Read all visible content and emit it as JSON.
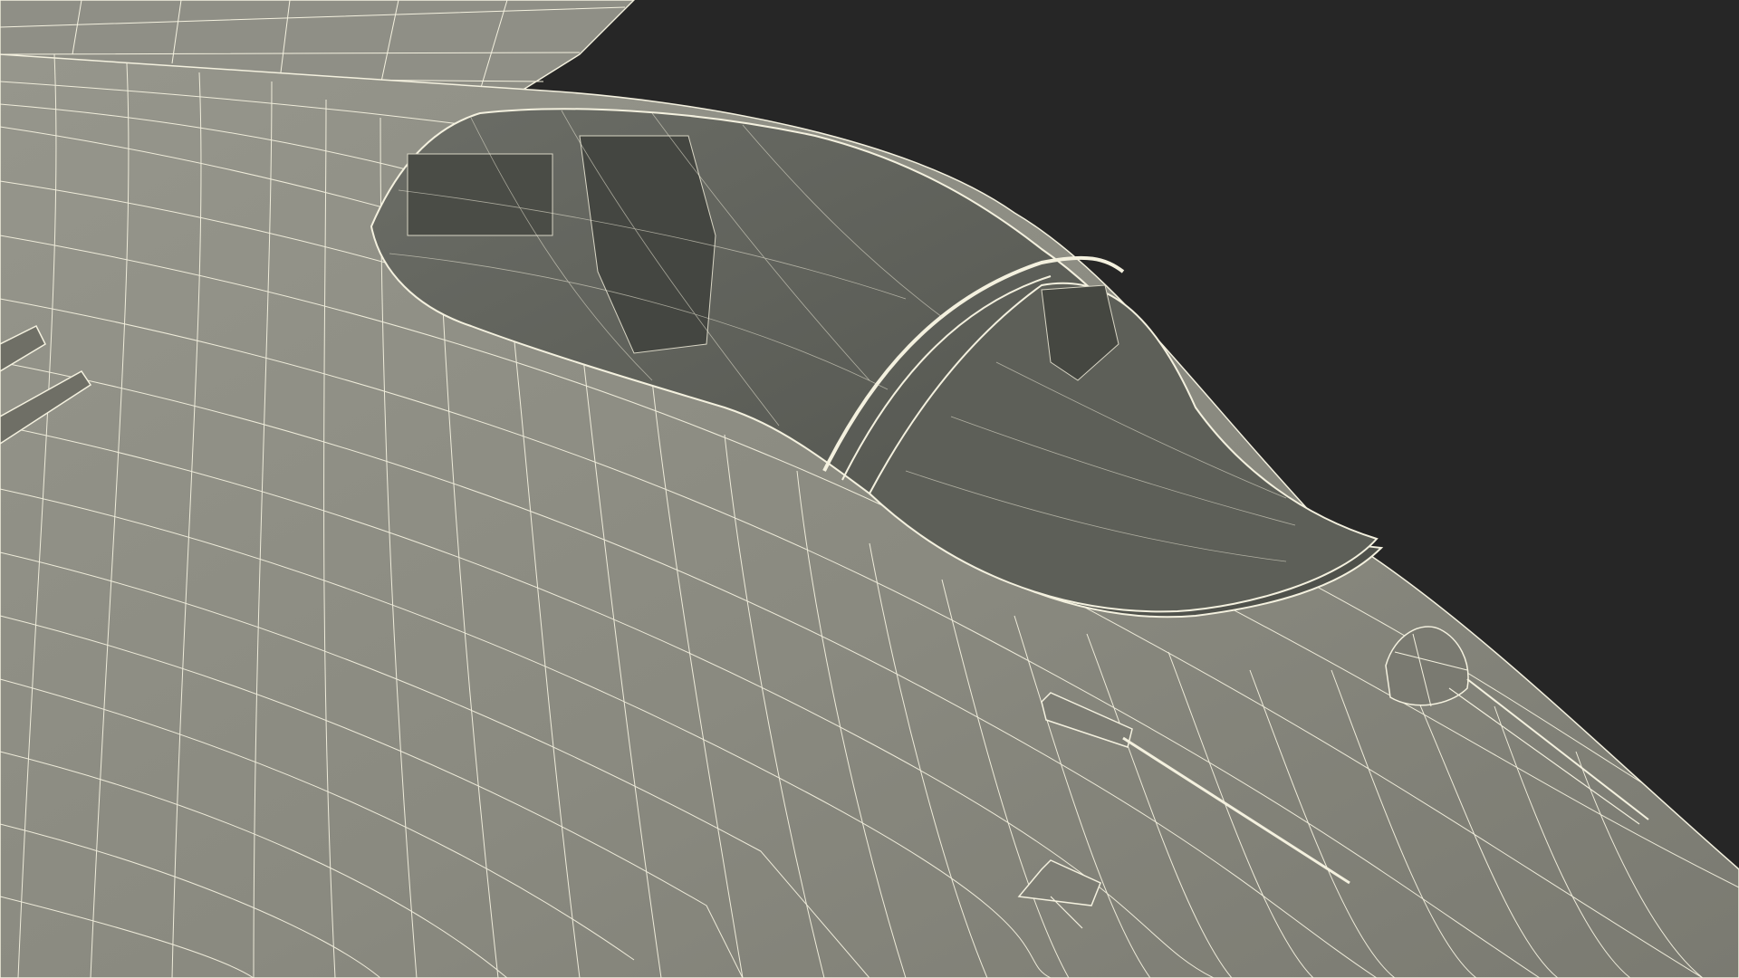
{
  "scene": {
    "subject": "wireframe-jet-fighter-cockpit",
    "colors": {
      "background": "#262626",
      "hull_fill": "#8a8a80",
      "hull_shade": "#707068",
      "wire": "#f4f1df",
      "canopy_glass": "#5a5c55",
      "canopy_interior": "#3f413c"
    }
  }
}
